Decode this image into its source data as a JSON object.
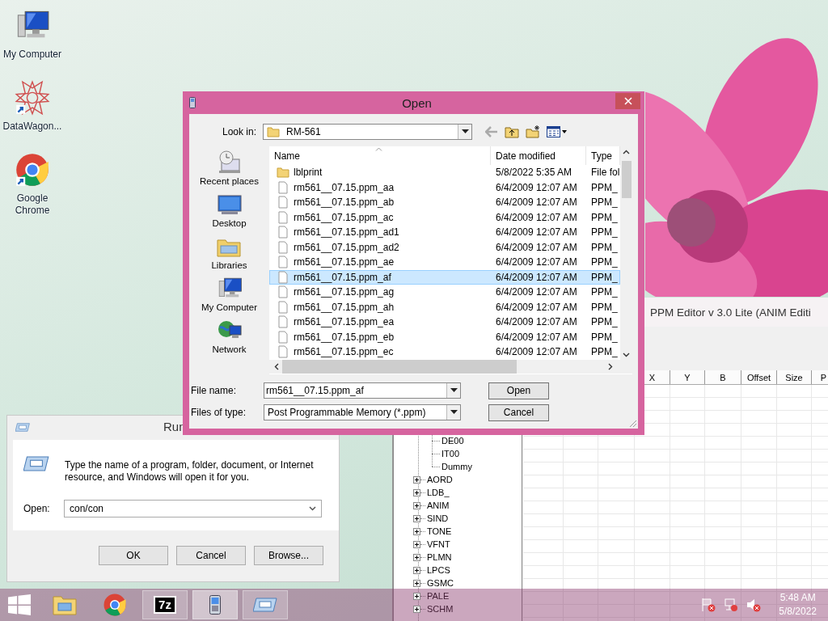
{
  "desktop_icons": [
    {
      "label": "My Computer",
      "kind": "computer",
      "shortcut": false
    },
    {
      "label": "DataWagon...",
      "kind": "star",
      "shortcut": true
    },
    {
      "label": "Google Chrome",
      "kind": "chrome",
      "shortcut": true
    }
  ],
  "ppm_editor": {
    "title": "PPM Editor v 3.0 Lite (ANIM Editi",
    "columns": [
      "X",
      "Y",
      "B",
      "Offset",
      "Size",
      "P"
    ],
    "tree": [
      {
        "expanded": true,
        "children": [
          {
            "label": "DE00"
          },
          {
            "label": "IT00"
          },
          {
            "label": "Dummy"
          }
        ]
      },
      {
        "label": "AORD",
        "expanded": false
      },
      {
        "label": "LDB_",
        "expanded": false
      },
      {
        "label": "ANIM",
        "expanded": false
      },
      {
        "label": "SIND",
        "expanded": false
      },
      {
        "label": "TONE",
        "expanded": false
      },
      {
        "label": "VFNT",
        "expanded": false
      },
      {
        "label": "PLMN",
        "expanded": false
      },
      {
        "label": "LPCS",
        "expanded": false
      },
      {
        "label": "GSMC",
        "expanded": false
      },
      {
        "label": "PALE",
        "expanded": false
      },
      {
        "label": "SCHM",
        "expanded": false
      }
    ]
  },
  "run_dialog": {
    "title": "Run",
    "prompt": "Type the name of a program, folder, document, or Internet resource, and Windows will open it for you.",
    "open_label": "Open:",
    "open_value": "con/con",
    "buttons": [
      "OK",
      "Cancel",
      "Browse..."
    ]
  },
  "open_dialog": {
    "title": "Open",
    "look_in_label": "Look in:",
    "look_in_value": "RM-561",
    "places": [
      {
        "label": "Recent places",
        "kind": "recent"
      },
      {
        "label": "Desktop",
        "kind": "desktop"
      },
      {
        "label": "Libraries",
        "kind": "libraries"
      },
      {
        "label": "My Computer",
        "kind": "computer"
      },
      {
        "label": "Network",
        "kind": "network"
      }
    ],
    "columns": [
      "Name",
      "Date modified",
      "Type"
    ],
    "files": [
      {
        "name": "lblprint",
        "date": "5/8/2022 5:35 AM",
        "type": "File fol",
        "kind": "folder",
        "selected": false
      },
      {
        "name": "rm561__07.15.ppm_aa",
        "date": "6/4/2009 12:07 AM",
        "type": "PPM_",
        "kind": "file",
        "selected": false
      },
      {
        "name": "rm561__07.15.ppm_ab",
        "date": "6/4/2009 12:07 AM",
        "type": "PPM_",
        "kind": "file",
        "selected": false
      },
      {
        "name": "rm561__07.15.ppm_ac",
        "date": "6/4/2009 12:07 AM",
        "type": "PPM_",
        "kind": "file",
        "selected": false
      },
      {
        "name": "rm561__07.15.ppm_ad1",
        "date": "6/4/2009 12:07 AM",
        "type": "PPM_",
        "kind": "file",
        "selected": false
      },
      {
        "name": "rm561__07.15.ppm_ad2",
        "date": "6/4/2009 12:07 AM",
        "type": "PPM_",
        "kind": "file",
        "selected": false
      },
      {
        "name": "rm561__07.15.ppm_ae",
        "date": "6/4/2009 12:07 AM",
        "type": "PPM_",
        "kind": "file",
        "selected": false
      },
      {
        "name": "rm561__07.15.ppm_af",
        "date": "6/4/2009 12:07 AM",
        "type": "PPM_",
        "kind": "file",
        "selected": true
      },
      {
        "name": "rm561__07.15.ppm_ag",
        "date": "6/4/2009 12:07 AM",
        "type": "PPM_",
        "kind": "file",
        "selected": false
      },
      {
        "name": "rm561__07.15.ppm_ah",
        "date": "6/4/2009 12:07 AM",
        "type": "PPM_",
        "kind": "file",
        "selected": false
      },
      {
        "name": "rm561__07.15.ppm_ea",
        "date": "6/4/2009 12:07 AM",
        "type": "PPM_",
        "kind": "file",
        "selected": false
      },
      {
        "name": "rm561__07.15.ppm_eb",
        "date": "6/4/2009 12:07 AM",
        "type": "PPM_",
        "kind": "file",
        "selected": false
      },
      {
        "name": "rm561__07.15.ppm_ec",
        "date": "6/4/2009 12:07 AM",
        "type": "PPM_",
        "kind": "file",
        "selected": false
      }
    ],
    "file_name_label": "File name:",
    "file_name": "rm561__07.15.ppm_af",
    "type_label": "Files of type:",
    "type_value": "Post Programmable Memory (*.ppm)",
    "buttons": [
      "Open",
      "Cancel"
    ]
  },
  "taskbar": {
    "apps": [
      {
        "kind": "explorer",
        "running": false,
        "active": false
      },
      {
        "kind": "chrome",
        "running": false,
        "active": false
      },
      {
        "kind": "archive",
        "logo_text": "7z",
        "running": true,
        "active": false
      },
      {
        "kind": "phone",
        "running": true,
        "active": true
      },
      {
        "kind": "run",
        "running": true,
        "active": false
      }
    ],
    "time": "5:48 AM",
    "date": "5/8/2022"
  }
}
